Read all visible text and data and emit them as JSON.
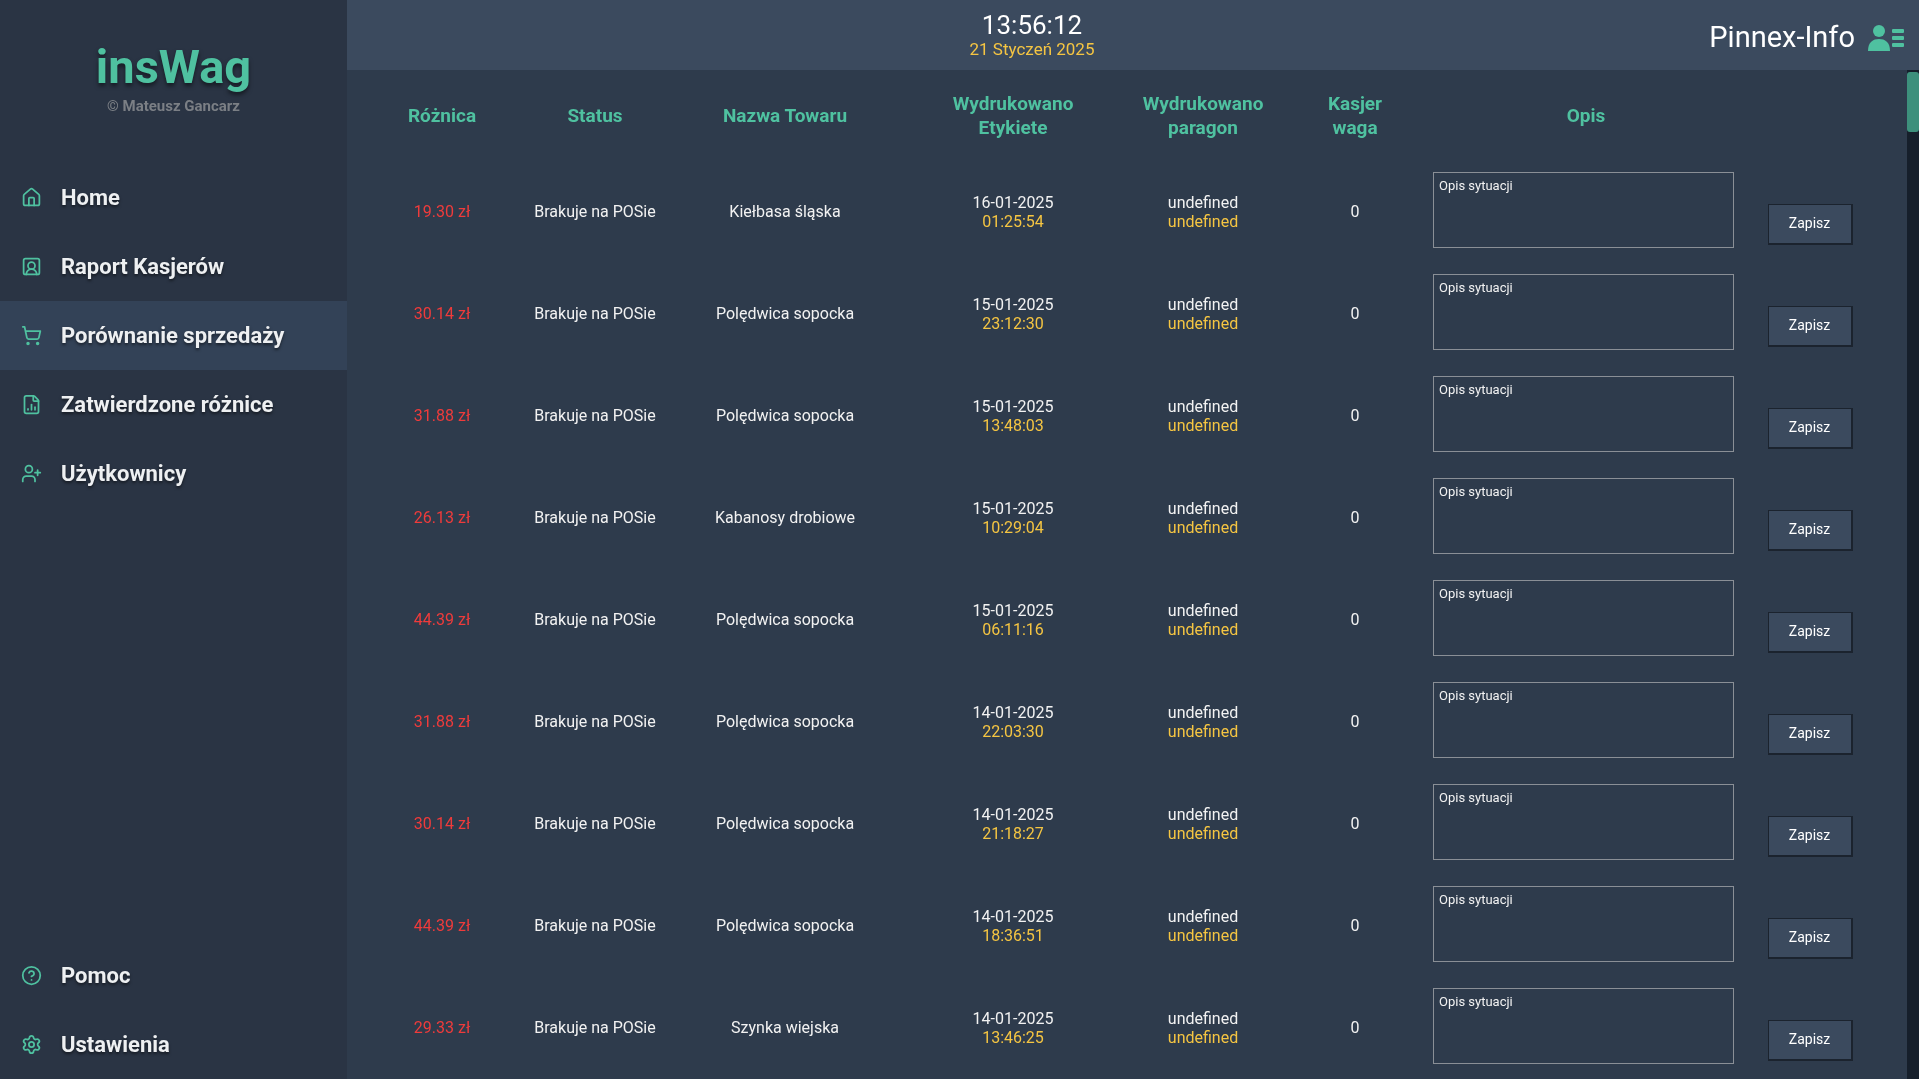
{
  "sidebar": {
    "logo": "insWag",
    "copyright": "© Mateusz Gancarz",
    "items": [
      {
        "kind": "home",
        "label": "Home",
        "selected": false
      },
      {
        "kind": "report",
        "label": "Raport Kasjerów",
        "selected": false
      },
      {
        "kind": "cart",
        "label": "Porównanie sprzedaży",
        "selected": true
      },
      {
        "kind": "chart",
        "label": "Zatwierdzone różnice",
        "selected": false
      },
      {
        "kind": "users",
        "label": "Użytkownicy",
        "selected": false
      }
    ],
    "bottom_items": [
      {
        "kind": "help",
        "label": "Pomoc",
        "selected": false
      },
      {
        "kind": "settings",
        "label": "Ustawienia",
        "selected": false
      }
    ]
  },
  "header": {
    "time": "13:56:12",
    "date": "21 Styczeń 2025",
    "user": "Pinnex-Info"
  },
  "table": {
    "columns": [
      "Różnica",
      "Status",
      "Nazwa Towaru",
      "Wydrukowano Etykiete",
      "Wydrukowano paragon",
      "Kasjer waga",
      "Opis"
    ],
    "rows": [
      {
        "difference": "19.30 zł",
        "status": "Brakuje na POSie",
        "product": "Kiełbasa śląska",
        "label_date": "16-01-2025",
        "label_time": "01:25:54",
        "receipt": "undefined",
        "receipt_time": "undefined",
        "weight": "0",
        "note_placeholder": "Opis sytuacji",
        "button": "Zapisz"
      },
      {
        "difference": "30.14 zł",
        "status": "Brakuje na POSie",
        "product": "Polędwica sopocka",
        "label_date": "15-01-2025",
        "label_time": "23:12:30",
        "receipt": "undefined",
        "receipt_time": "undefined",
        "weight": "0",
        "note_placeholder": "Opis sytuacji",
        "button": "Zapisz"
      },
      {
        "difference": "31.88 zł",
        "status": "Brakuje na POSie",
        "product": "Polędwica sopocka",
        "label_date": "15-01-2025",
        "label_time": "13:48:03",
        "receipt": "undefined",
        "receipt_time": "undefined",
        "weight": "0",
        "note_placeholder": "Opis sytuacji",
        "button": "Zapisz"
      },
      {
        "difference": "26.13 zł",
        "status": "Brakuje na POSie",
        "product": "Kabanosy drobiowe",
        "label_date": "15-01-2025",
        "label_time": "10:29:04",
        "receipt": "undefined",
        "receipt_time": "undefined",
        "weight": "0",
        "note_placeholder": "Opis sytuacji",
        "button": "Zapisz"
      },
      {
        "difference": "44.39 zł",
        "status": "Brakuje na POSie",
        "product": "Polędwica sopocka",
        "label_date": "15-01-2025",
        "label_time": "06:11:16",
        "receipt": "undefined",
        "receipt_time": "undefined",
        "weight": "0",
        "note_placeholder": "Opis sytuacji",
        "button": "Zapisz"
      },
      {
        "difference": "31.88 zł",
        "status": "Brakuje na POSie",
        "product": "Polędwica sopocka",
        "label_date": "14-01-2025",
        "label_time": "22:03:30",
        "receipt": "undefined",
        "receipt_time": "undefined",
        "weight": "0",
        "note_placeholder": "Opis sytuacji",
        "button": "Zapisz"
      },
      {
        "difference": "30.14 zł",
        "status": "Brakuje na POSie",
        "product": "Polędwica sopocka",
        "label_date": "14-01-2025",
        "label_time": "21:18:27",
        "receipt": "undefined",
        "receipt_time": "undefined",
        "weight": "0",
        "note_placeholder": "Opis sytuacji",
        "button": "Zapisz"
      },
      {
        "difference": "44.39 zł",
        "status": "Brakuje na POSie",
        "product": "Polędwica sopocka",
        "label_date": "14-01-2025",
        "label_time": "18:36:51",
        "receipt": "undefined",
        "receipt_time": "undefined",
        "weight": "0",
        "note_placeholder": "Opis sytuacji",
        "button": "Zapisz"
      },
      {
        "difference": "29.33 zł",
        "status": "Brakuje na POSie",
        "product": "Szynka wiejska",
        "label_date": "14-01-2025",
        "label_time": "13:46:25",
        "receipt": "undefined",
        "receipt_time": "undefined",
        "weight": "0",
        "note_placeholder": "Opis sytuacji",
        "button": "Zapisz"
      }
    ]
  }
}
